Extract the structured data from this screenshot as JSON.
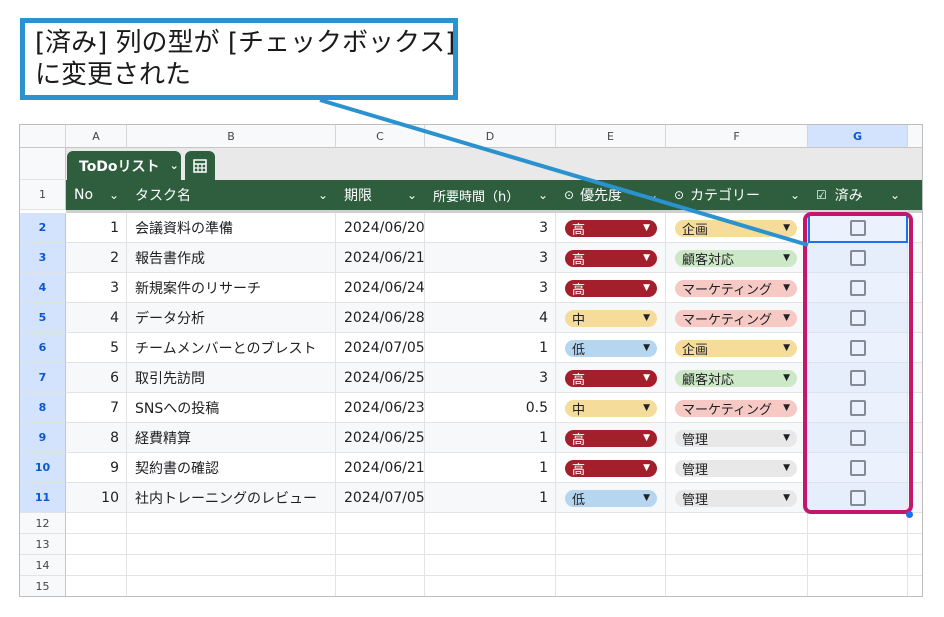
{
  "callout": {
    "line1": "[済み] 列の型が [チェックボックス]",
    "line2": "に変更された"
  },
  "columns": [
    "A",
    "B",
    "C",
    "D",
    "E",
    "F",
    "G"
  ],
  "row_numbers": [
    "1",
    "2",
    "3",
    "4",
    "5",
    "6",
    "7",
    "8",
    "9",
    "10",
    "11",
    "12",
    "13",
    "14",
    "15"
  ],
  "table": {
    "tab_name": "ToDoリスト",
    "headers": {
      "no": "No",
      "task": "タスク名",
      "due": "期限",
      "time": "所要時間（h）",
      "priority": "優先度",
      "category": "カテゴリー",
      "done": "済み"
    },
    "rows": [
      {
        "no": "1",
        "task": "会議資料の準備",
        "due": "2024/06/20",
        "time": "3",
        "priority": "高",
        "category": "企画"
      },
      {
        "no": "2",
        "task": "報告書作成",
        "due": "2024/06/21",
        "time": "3",
        "priority": "高",
        "category": "顧客対応"
      },
      {
        "no": "3",
        "task": "新規案件のリサーチ",
        "due": "2024/06/24",
        "time": "3",
        "priority": "高",
        "category": "マーケティング"
      },
      {
        "no": "4",
        "task": "データ分析",
        "due": "2024/06/28",
        "time": "4",
        "priority": "中",
        "category": "マーケティング"
      },
      {
        "no": "5",
        "task": "チームメンバーとのブレスト",
        "due": "2024/07/05",
        "time": "1",
        "priority": "低",
        "category": "企画"
      },
      {
        "no": "6",
        "task": "取引先訪問",
        "due": "2024/06/25",
        "time": "3",
        "priority": "高",
        "category": "顧客対応"
      },
      {
        "no": "7",
        "task": "SNSへの投稿",
        "due": "2024/06/23",
        "time": "0.5",
        "priority": "中",
        "category": "マーケティング"
      },
      {
        "no": "8",
        "task": "経費精算",
        "due": "2024/06/25",
        "time": "1",
        "priority": "高",
        "category": "管理"
      },
      {
        "no": "9",
        "task": "契約書の確認",
        "due": "2024/06/21",
        "time": "1",
        "priority": "高",
        "category": "管理"
      },
      {
        "no": "10",
        "task": "社内トレーニングのレビュー",
        "due": "2024/07/05",
        "time": "1",
        "priority": "低",
        "category": "管理"
      }
    ]
  },
  "colors": {
    "header_green": "#2f5e3e",
    "callout_blue": "#2a92cf",
    "highlight_pink": "#c2186b",
    "priority": {
      "高": "#a31f2c",
      "中": "#f6dc9a",
      "低": "#b6d5ef"
    },
    "category": {
      "企画": "#f6dc9a",
      "顧客対応": "#cde8c6",
      "マーケティング": "#f6c9c4",
      "管理": "#e8e8e8"
    }
  }
}
